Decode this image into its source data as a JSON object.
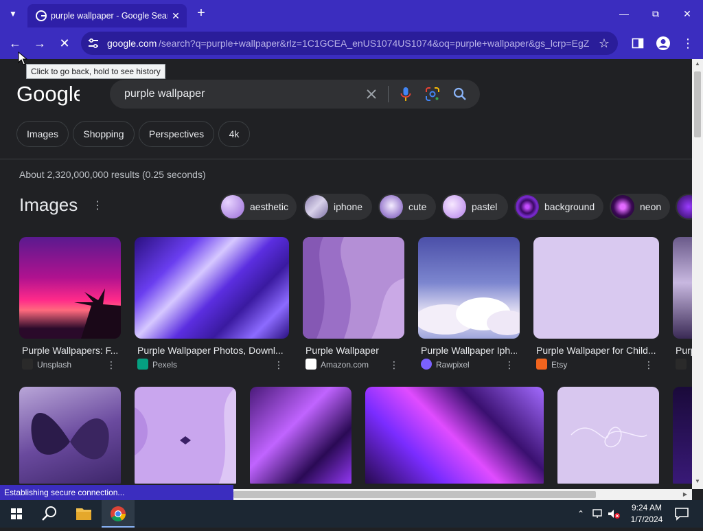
{
  "browser": {
    "tab_title": "purple wallpaper - Google Search",
    "url_host": "google.com",
    "url_rest": "/search?q=purple+wallpaper&rlz=1C1GCEA_enUS1074US1074&oq=purple+wallpaper&gs_lcrp=EgZ...",
    "tooltip": "Click to go back, hold to see history",
    "status": "Establishing secure connection..."
  },
  "search": {
    "logo": "Google",
    "query": "purple wallpaper",
    "filters": [
      "Images",
      "Shopping",
      "Perspectives",
      "4k"
    ],
    "result_stats": "About 2,320,000,000 results (0.25 seconds)"
  },
  "images_section": {
    "heading": "Images",
    "related": [
      "aesthetic",
      "iphone",
      "cute",
      "pastel",
      "background",
      "neon"
    ],
    "results": [
      {
        "caption": "Purple Wallpapers: F...",
        "source": "Unsplash"
      },
      {
        "caption": "Purple Wallpaper Photos, Downl...",
        "source": "Pexels"
      },
      {
        "caption": "Purple Wallpaper",
        "source": "Amazon.com"
      },
      {
        "caption": "Purple Wallpaper Iph...",
        "source": "Rawpixel"
      },
      {
        "caption": "Purple Wallpaper for Child...",
        "source": "Etsy"
      },
      {
        "caption": "Purp",
        "source": ""
      }
    ]
  },
  "taskbar": {
    "time": "9:24 AM",
    "date": "1/7/2024"
  },
  "colors": {
    "chrome_frame": "#3b2dbf",
    "page_bg": "#202124",
    "taskbar_bg": "#1c2733"
  }
}
